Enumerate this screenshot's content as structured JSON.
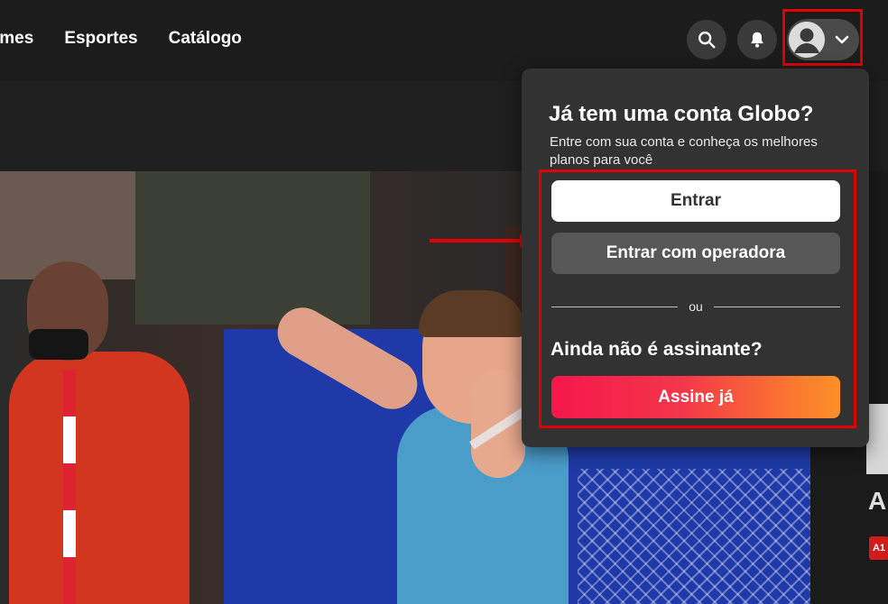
{
  "nav": {
    "items": [
      "lmes",
      "Esportes",
      "Catálogo"
    ]
  },
  "header": {
    "icons": [
      "search-icon",
      "bell-icon",
      "user-avatar-icon",
      "chevron-down-icon"
    ]
  },
  "login_popup": {
    "title": "Já tem uma conta Globo?",
    "subtitle": "Entre com sua conta e conheça os melhores planos para você",
    "login_button": "Entrar",
    "operator_button": "Entrar com operadora",
    "divider_text": "ou",
    "not_subscriber": "Ainda não é assinante?",
    "subscribe_button": "Assine já"
  },
  "side_panel": {
    "letter": "A",
    "age_rating": "A1"
  },
  "colors": {
    "highlight": "#e10000",
    "subscribe_gradient_start": "#f4174b",
    "subscribe_gradient_end": "#fd9127",
    "popup_bg": "#323232"
  }
}
